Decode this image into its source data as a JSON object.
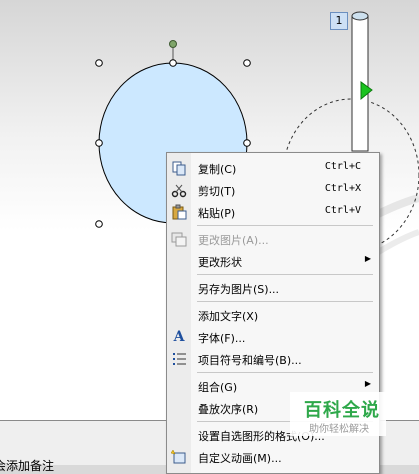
{
  "slide": {
    "number": "1"
  },
  "notes": {
    "placeholder": "会添加备注"
  },
  "menu": {
    "items": [
      {
        "label": "复制(C)",
        "shortcut": "Ctrl+C",
        "icon": "copy-icon",
        "enabled": true
      },
      {
        "label": "剪切(T)",
        "shortcut": "Ctrl+X",
        "icon": "cut-icon",
        "enabled": true
      },
      {
        "label": "粘贴(P)",
        "shortcut": "Ctrl+V",
        "icon": "paste-icon",
        "enabled": true
      },
      {
        "label": "更改图片(A)...",
        "icon": "change-picture-icon",
        "enabled": false
      },
      {
        "label": "更改形状",
        "submenu": true,
        "enabled": true
      },
      {
        "label": "另存为图片(S)...",
        "enabled": true
      },
      {
        "label": "添加文字(X)",
        "enabled": true
      },
      {
        "label": "字体(F)...",
        "icon": "font-icon",
        "enabled": true
      },
      {
        "label": "项目符号和编号(B)...",
        "icon": "bullets-icon",
        "enabled": true
      },
      {
        "label": "组合(G)",
        "submenu": true,
        "enabled": true
      },
      {
        "label": "叠放次序(R)",
        "enabled": true
      },
      {
        "label": "设置自选图形的格式(O)...",
        "enabled": true
      },
      {
        "label": "自定义动画(M)...",
        "icon": "custom-animation-icon",
        "enabled": true
      }
    ]
  },
  "watermark": {
    "title": "百科全说",
    "subtitle": "助你轻松解决"
  },
  "colors": {
    "ellipse_fill": "#cce8ff",
    "rotate_handle": "#7fa56a",
    "motion_arrow": "#19c21e"
  }
}
